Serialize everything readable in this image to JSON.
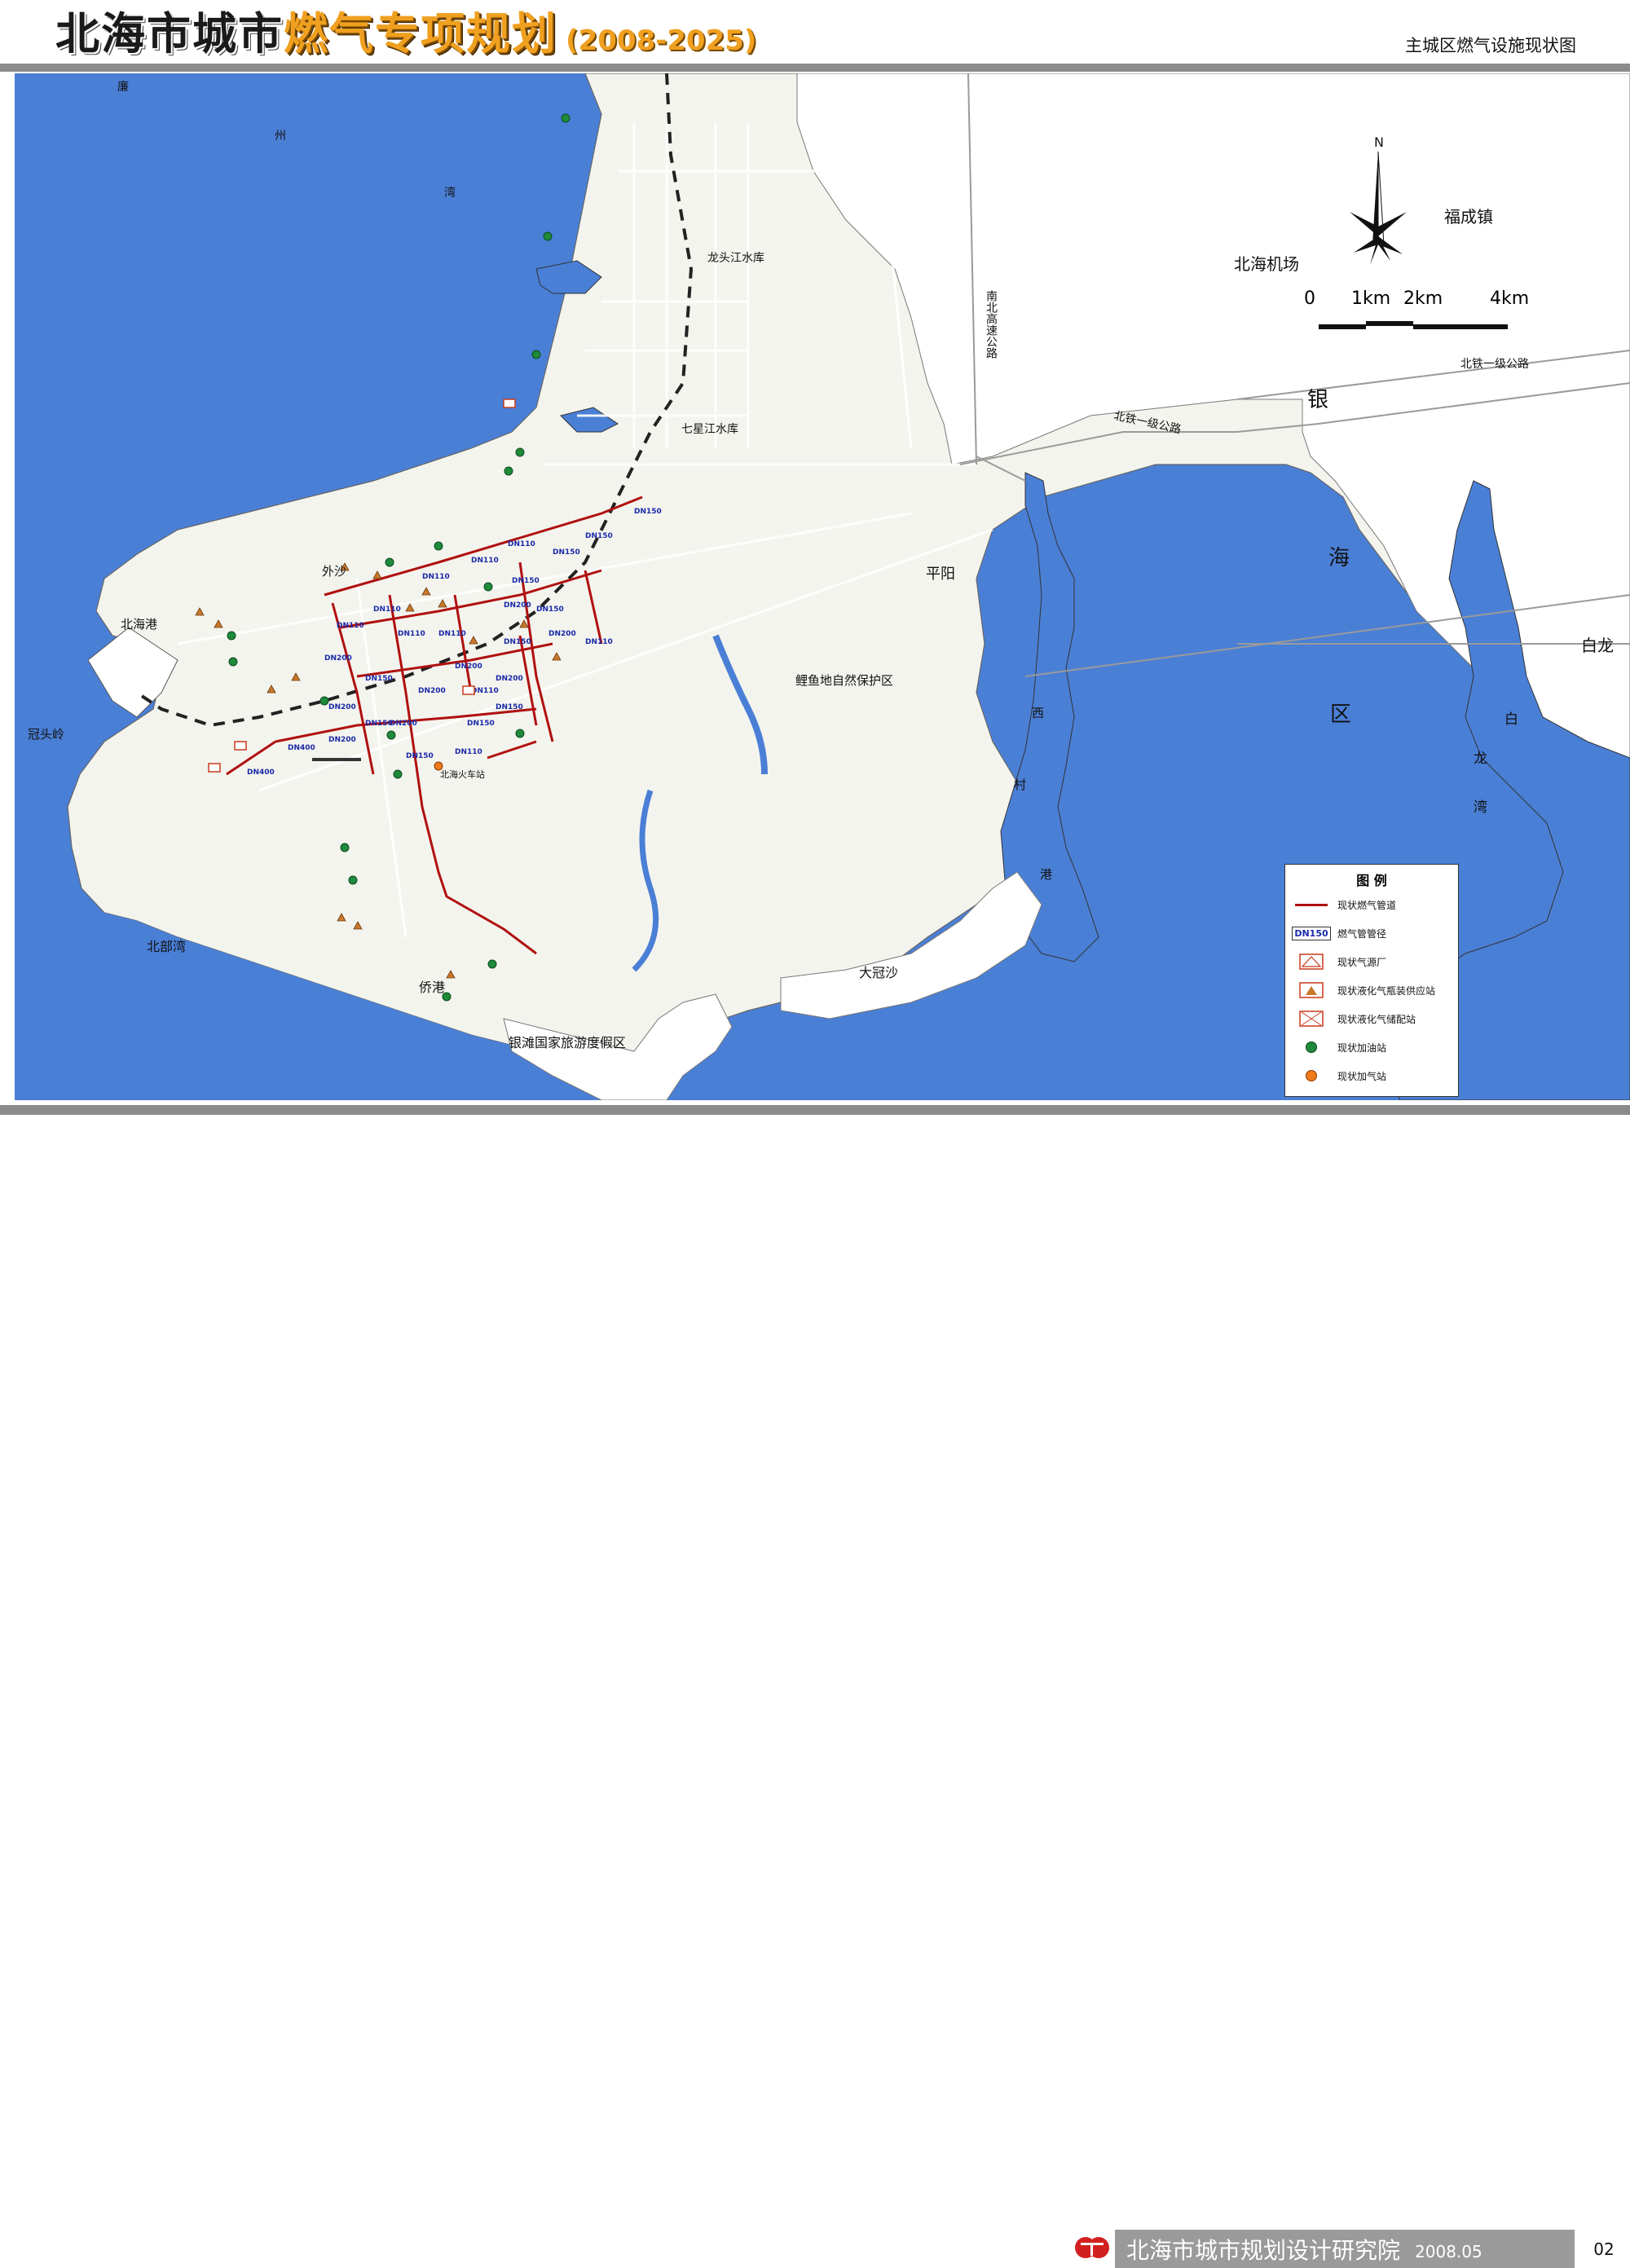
{
  "header": {
    "title_black": "北海市城市",
    "title_orange": "燃气专项规划",
    "title_years": "(2008-2025)",
    "subtitle": "主城区燃气设施现状图"
  },
  "footer": {
    "institute": "北海市城市规划设计研究院",
    "date": "2008.05",
    "page": "02"
  },
  "scale": {
    "labels": [
      "0",
      "1km",
      "2km",
      "4km"
    ],
    "north": "N"
  },
  "legend": {
    "title": "图 例",
    "items": [
      {
        "symbol": "pipe-line",
        "label": "现状燃气管道",
        "color": "#b01010"
      },
      {
        "symbol": "diameter-tag",
        "label": "燃气管管径",
        "tag": "DN150",
        "color": "#1a2aa8"
      },
      {
        "symbol": "gas-plant",
        "label": "现状气源厂",
        "color": "#c83a1a"
      },
      {
        "symbol": "lpg-bottle-station",
        "label": "现状液化气瓶装供应站",
        "color": "#c8782a"
      },
      {
        "symbol": "lpg-storage-station",
        "label": "现状液化气储配站",
        "color": "#c83a1a"
      },
      {
        "symbol": "fuel-station",
        "label": "现状加油站",
        "color": "#1e8a3a"
      },
      {
        "symbol": "cng-station",
        "label": "现状加气站",
        "color": "#f07a1a"
      }
    ]
  },
  "colors": {
    "sea": "#4a7fd6",
    "land": "#f4f4ee",
    "road": "#ffffff",
    "pipe": "#b01010",
    "frame_gray": "#8b8b8b"
  },
  "map_labels": {
    "lian": "廉",
    "zhou": "州",
    "wan1": "湾",
    "beihai_gang": "北海港",
    "waisha": "外沙",
    "guantouling": "冠头岭",
    "beibu_wan": "北部湾",
    "qiao_gang": "侨港",
    "yintan": "银滩国家旅游度假区",
    "longtoujiang": "龙头江水库",
    "qixingjiang": "七星江水库",
    "pingyang": "平阳",
    "liyudi": "鲤鱼地自然保护区",
    "daguansha": "大冠沙",
    "fuchengzhen": "福成镇",
    "beihai_airport": "北海机场",
    "nanbei_gaosu": "南北高速公路",
    "beitie_1": "北铁一级公路",
    "beitie_2": "北铁一级公路",
    "yin": "银",
    "hai": "海",
    "qu": "区",
    "bailong": "白龙",
    "bai": "白",
    "long": "龙",
    "wan2": "湾",
    "xi": "西",
    "cun": "村",
    "gang": "港",
    "beihai_station": "北海火车站"
  },
  "dn_tags": [
    "DN150",
    "DN150",
    "DN150",
    "DN110",
    "DN110",
    "DN110",
    "DN150",
    "DN200",
    "DN200",
    "DN110",
    "DN110",
    "DN200",
    "DN150",
    "DN200",
    "DN110",
    "DN200",
    "DN200",
    "DN150",
    "DN200",
    "DN150",
    "DN110",
    "DN200",
    "DN150",
    "DN110",
    "DN200",
    "DN400",
    "DN400",
    "DN110",
    "DN150",
    "DN150",
    "DN110",
    "DN150"
  ]
}
